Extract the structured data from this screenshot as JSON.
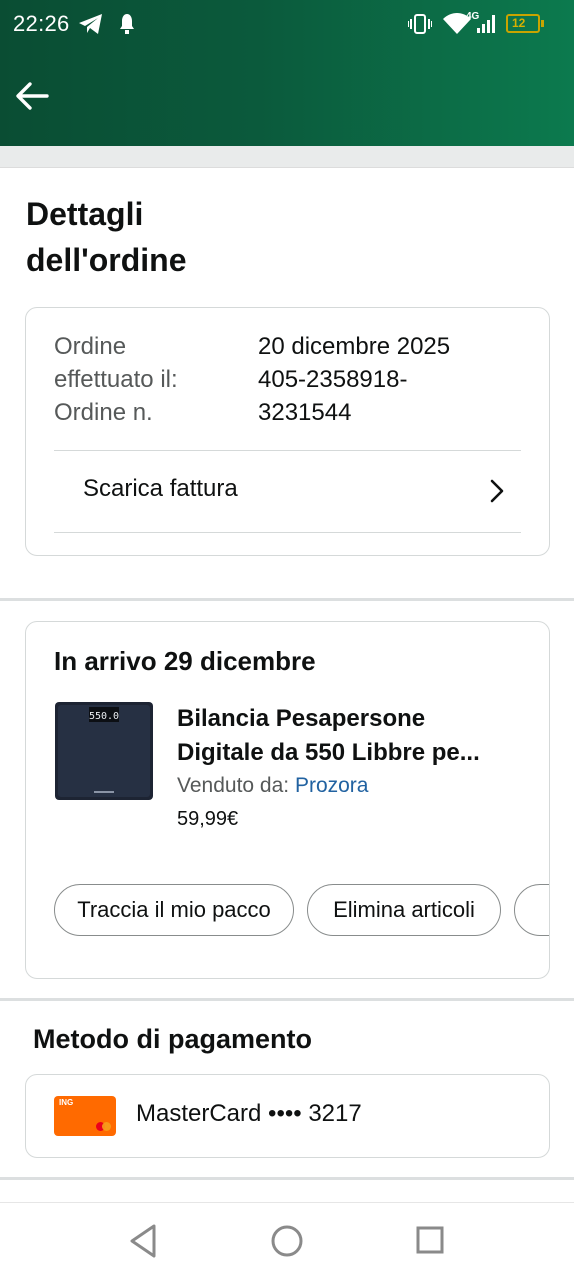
{
  "status_bar": {
    "time": "22:26",
    "network": "4G",
    "battery": "12",
    "icons": [
      "telegram-icon",
      "notification-icon",
      "vibrate-icon",
      "wifi-icon",
      "signal-icon",
      "battery-icon"
    ]
  },
  "header": {
    "back_icon": "arrow-left-icon"
  },
  "page": {
    "title_line1": "Dettagli",
    "title_line2": "dell'ordine"
  },
  "order_info": {
    "placed_label_line1": "Ordine",
    "placed_label_line2": "effettuato il:",
    "number_label": "Ordine n.",
    "placed_date": "20 dicembre 2025",
    "number_line1": "405-2358918-",
    "number_line2": "3231544",
    "invoice_label": "Scarica fattura"
  },
  "shipment": {
    "title": "In arrivo 29 dicembre",
    "product_line1": "Bilancia Pesapersone",
    "product_line2": "Digitale da 550 Libbre pe...",
    "sold_by_label": "Venduto da:",
    "seller": "Prozora",
    "price": "59,99€",
    "scale_display": "550.0",
    "actions": [
      "Traccia il mio pacco",
      "Elimina articoli"
    ]
  },
  "payment": {
    "title": "Metodo di pagamento",
    "card_brand_mark": "ING",
    "card_text": "MasterCard •••• 3217"
  },
  "colors": {
    "header_dark": "#0a4d33",
    "header_light": "#0c7a4e",
    "link": "#2162a1",
    "card_orange": "#ff6a00"
  }
}
